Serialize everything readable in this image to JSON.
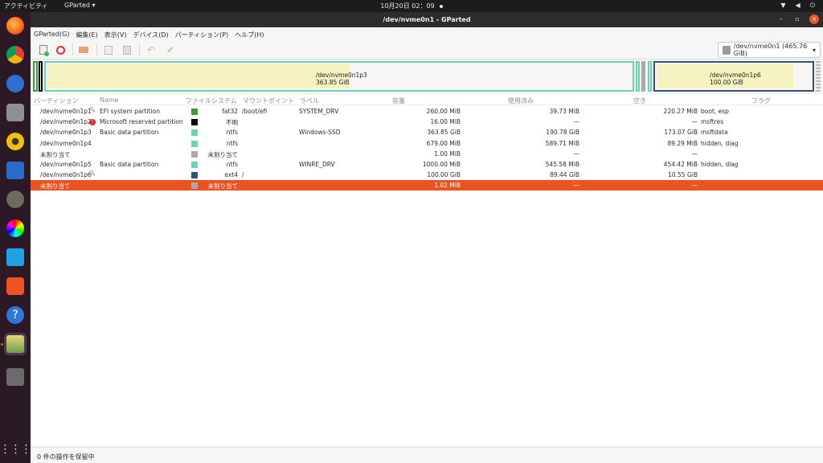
{
  "topbar": {
    "activities": "アクティビティ",
    "app_menu": "GParted ▾",
    "clock": "10月20日  02：09"
  },
  "window": {
    "title": "/dev/nvme0n1 - GParted"
  },
  "menu": [
    "GParted(G)",
    "編集(E)",
    "表示(V)",
    "デバイス(D)",
    "パーティション(P)",
    "ヘルプ(H)"
  ],
  "device_selector": "/dev/nvme0n1 (465.76 GiB)",
  "map": {
    "p3": {
      "name": "/dev/nvme0n1p3",
      "size": "363.85 GiB",
      "used_fraction": 0.52
    },
    "p6": {
      "name": "/dev/nvme0n1p6",
      "size": "100.00 GiB",
      "used_fraction": 0.89
    }
  },
  "columns": {
    "partition": "パーティション",
    "name": "Name",
    "filesystem": "ファイルシステム",
    "mount": "マウントポイント",
    "label": "ラベル",
    "size": "容量",
    "used": "使用済み",
    "free": "空き",
    "flags": "フラグ"
  },
  "rows": [
    {
      "partition": "/dev/nvme0n1p1",
      "name": "EFI system partition",
      "color": "#3c9c3c",
      "fs": "fat32",
      "mount": "/boot/efi",
      "label": "SYSTEM_DRV",
      "size": "260.00 MiB",
      "used": "39.73 MiB",
      "free": "220.27 MiB",
      "flags": "boot, esp",
      "icon": "search"
    },
    {
      "partition": "/dev/nvme0n1p2",
      "name": "Microsoft reserved partition",
      "color": "#000000",
      "fs": "不明",
      "mount": "",
      "label": "",
      "size": "16.00 MiB",
      "used": "—",
      "free": "—",
      "flags": "msftres",
      "icon": "warning"
    },
    {
      "partition": "/dev/nvme0n1p3",
      "name": "Basic data partition",
      "color": "#6ed3b0",
      "fs": "ntfs",
      "mount": "",
      "label": "Windows-SSD",
      "size": "363.85 GiB",
      "used": "190.78 GiB",
      "free": "173.07 GiB",
      "flags": "msftdata",
      "icon": ""
    },
    {
      "partition": "/dev/nvme0n1p4",
      "name": "",
      "color": "#6ed3b0",
      "fs": "ntfs",
      "mount": "",
      "label": "",
      "size": "679.00 MiB",
      "used": "589.71 MiB",
      "free": "89.29 MiB",
      "flags": "hidden, diag",
      "icon": ""
    },
    {
      "partition": "未割り当て",
      "name": "",
      "color": "#a9a9a9",
      "fs": "未割り当て",
      "mount": "",
      "label": "",
      "size": "1.00 MiB",
      "used": "—",
      "free": "—",
      "flags": "",
      "icon": ""
    },
    {
      "partition": "/dev/nvme0n1p5",
      "name": "Basic data partition",
      "color": "#6ed3b0",
      "fs": "ntfs",
      "mount": "",
      "label": "WINRE_DRV",
      "size": "1000.00 MiB",
      "used": "545.58 MiB",
      "free": "454.42 MiB",
      "flags": "hidden, diag",
      "icon": ""
    },
    {
      "partition": "/dev/nvme0n1p6",
      "name": "",
      "color": "#3a5070",
      "fs": "ext4",
      "mount": "/",
      "label": "",
      "size": "100.00 GiB",
      "used": "89.44 GiB",
      "free": "10.55 GiB",
      "flags": "",
      "icon": "search"
    },
    {
      "partition": "未割り当て",
      "name": "",
      "color": "#a9a9a9",
      "fs": "未割り当て",
      "mount": "",
      "label": "",
      "size": "1.02 MiB",
      "used": "—",
      "free": "—",
      "flags": "",
      "icon": "",
      "selected": true
    }
  ],
  "status": "0 件の操作を保留中",
  "colors": {
    "accent": "#e95420",
    "ntfs": "#6ed3b0",
    "ext4": "#3a5070",
    "unallocated": "#a9a9a9"
  }
}
